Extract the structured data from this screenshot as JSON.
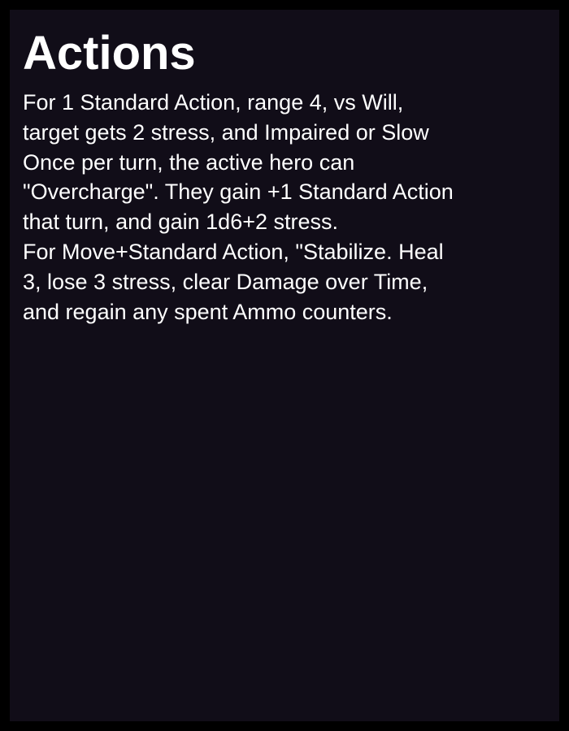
{
  "card": {
    "title": "Actions",
    "lines": [
      "For 1 Standard Action, range 4, vs Will,",
      "target gets 2 stress, and Impaired or Slow",
      "Once per turn, the active hero can",
      "\"Overcharge\". They gain +1 Standard Action",
      "that turn, and gain 1d6+2 stress.",
      "For Move+Standard Action, \"Stabilize. Heal",
      "3, lose 3 stress, clear Damage over Time,",
      "and regain any spent Ammo counters."
    ]
  },
  "colors": {
    "frame": "#000000",
    "background": "#110d18",
    "text": "#ffffff"
  }
}
